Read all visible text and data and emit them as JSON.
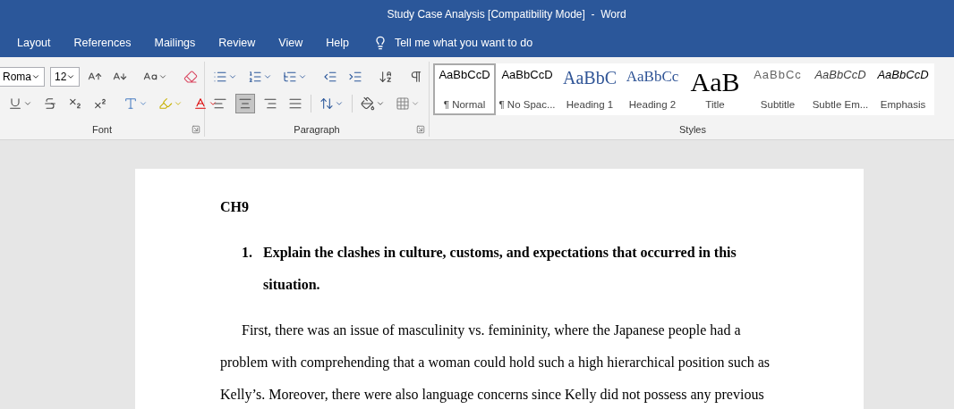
{
  "window": {
    "title": "Study Case Analysis [Compatibility Mode]  -  Word"
  },
  "tabs": [
    {
      "label": "Layout",
      "selected": false
    },
    {
      "label": "References",
      "selected": false
    },
    {
      "label": "Mailings",
      "selected": false
    },
    {
      "label": "Review",
      "selected": false
    },
    {
      "label": "View",
      "selected": false
    },
    {
      "label": "Help",
      "selected": false
    }
  ],
  "tell_me": {
    "placeholder": "Tell me what you want to do"
  },
  "font_group": {
    "label": "Font",
    "font_name": "Roma",
    "font_size": "12"
  },
  "paragraph_group": {
    "label": "Paragraph",
    "alignment": [
      {
        "selected": false
      },
      {
        "selected": true
      },
      {
        "selected": false
      },
      {
        "selected": false
      }
    ]
  },
  "styles_group": {
    "label": "Styles",
    "styles": [
      {
        "kind": "normal",
        "preview": "AaBbCcD",
        "name": "¶ Normal",
        "selected": true
      },
      {
        "kind": "no-spacing",
        "preview": "AaBbCcD",
        "name": "¶ No Spac...",
        "selected": false
      },
      {
        "kind": "heading1",
        "preview": "AaBbC",
        "name": "Heading 1",
        "selected": false
      },
      {
        "kind": "heading2",
        "preview": "AaBbCc",
        "name": "Heading 2",
        "selected": false
      },
      {
        "kind": "title",
        "preview": "AaB",
        "name": "Title",
        "selected": false
      },
      {
        "kind": "subtitle",
        "preview": "AaBbCc",
        "name": "Subtitle",
        "selected": false
      },
      {
        "kind": "subtle-emphasis",
        "preview": "AaBbCcD",
        "name": "Subtle Em...",
        "selected": false
      },
      {
        "kind": "emphasis",
        "preview": "AaBbCcD",
        "name": "Emphasis",
        "selected": false
      }
    ]
  },
  "document": {
    "heading": "CH9",
    "list_items": [
      {
        "number": "1.",
        "text": "Explain the clashes in culture, customs, and expectations that occurred in this situation."
      }
    ],
    "paragraphs": [
      "First, there was an issue of masculinity vs. femininity, where the Japanese people had a problem with comprehending that a woman could hold such a high hierarchical position such as Kelly’s. Moreover, there were also language concerns since Kelly did not possess any previous"
    ]
  }
}
